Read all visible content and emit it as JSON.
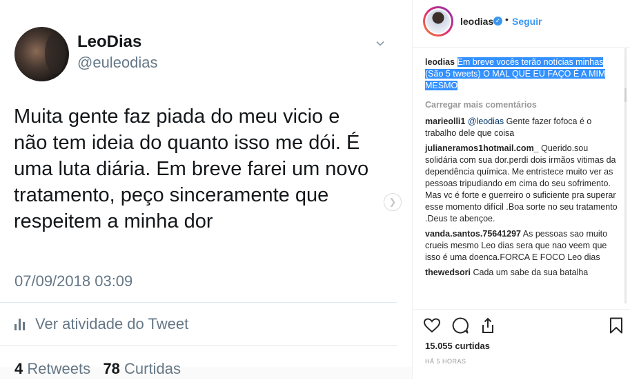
{
  "tweet": {
    "display_name": "LeoDias",
    "handle": "@euleodias",
    "text_lines": [
      "Muita gente faz piada do meu vicio e",
      "não tem ideia do quanto isso me dói. É",
      "uma luta diária. Em breve farei um novo",
      "tratamento, peço sinceramente que",
      "respeitem a minha dor"
    ],
    "date": "07/09/2018 03:09",
    "activity_label": "Ver atividade do Tweet",
    "retweets_count": "4",
    "retweets_label": "Retweets",
    "likes_count": "78",
    "likes_label": "Curtidas"
  },
  "instagram": {
    "username": "leodias",
    "dot": "•",
    "follow_label": "Seguir",
    "caption": {
      "user": "leodias",
      "text": "Em breve vocês terão notícias minhas (São 5 tweets) O MAL QUE EU FAÇO É A MIM MESMO"
    },
    "load_more": "Carregar mais comentários",
    "comments": [
      {
        "user": "marieolli1",
        "mention": "@leodias",
        "text": " Gente fazer fofoca é o trabalho dele que coisa"
      },
      {
        "user": "julianeramos1hotmail.com_",
        "mention": "",
        "text": " Querido.sou solidária com sua dor.perdi dois irmãos vitimas da dependência química. Me entristece muito ver as pessoas tripudiando em cima do seu sofrimento. Mas vc é forte e guerreiro o suficiente pra superar esse momento difícil .Boa sorte no seu tratamento .Deus te abençoe."
      },
      {
        "user": "vanda.santos.75641297",
        "mention": "",
        "text": " As pessoas sao muito crueis mesmo Leo dias sera que nao veem que isso é uma doenca.FORCA E FOCO Leo dias"
      },
      {
        "user": "thewedsori",
        "mention": "",
        "text": " Cada um sabe da sua batalha"
      }
    ],
    "likes": "15.055 curtidas",
    "time": "HÁ 5 HORAS"
  },
  "colors": {
    "twitter_blue": "#1da1f2",
    "instagram_blue": "#3897f0",
    "selection": "#3390ff"
  },
  "icons": [
    "chevron-down-icon",
    "bar-chart-icon",
    "chevron-right-icon",
    "verified-icon",
    "heart-icon",
    "comment-icon",
    "share-icon",
    "bookmark-icon"
  ]
}
